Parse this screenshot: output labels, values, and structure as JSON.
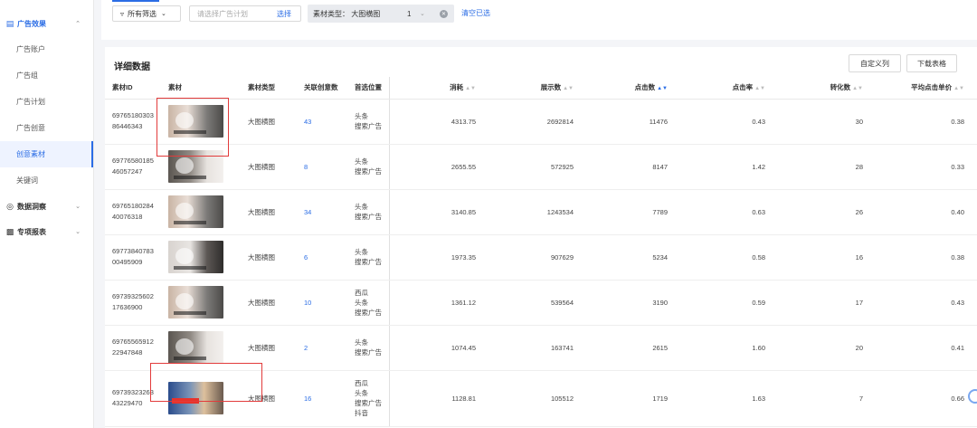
{
  "sidebar": {
    "group_ad": {
      "label": "广告效果",
      "icon": "ad-report-icon"
    },
    "items": [
      {
        "label": "广告账户"
      },
      {
        "label": "广告组"
      },
      {
        "label": "广告计划"
      },
      {
        "label": "广告创意"
      },
      {
        "label": "创意素材",
        "active": true
      },
      {
        "label": "关键词"
      }
    ],
    "group_insight": {
      "label": "数据洞察",
      "icon": "insight-icon"
    },
    "group_special": {
      "label": "专项报表",
      "icon": "bar-chart-icon"
    }
  },
  "filters": {
    "all_filter_label": "所有筛选",
    "plan_placeholder": "请选择广告计划",
    "plan_select_label": "选择",
    "tag_label": "素材类型：  大图横图",
    "tag_count": "1",
    "clear_label": "清空已选"
  },
  "card": {
    "title": "详细数据",
    "custom_columns_label": "自定义列",
    "download_label": "下载表格"
  },
  "table": {
    "columns": [
      "素材ID",
      "素材",
      "素材类型",
      "关联创意数",
      "首选位置",
      "消耗",
      "展示数",
      "点击数",
      "点击率",
      "转化数",
      "平均点击单价"
    ],
    "rows": [
      {
        "id1": "69765180303",
        "id2": "86446343",
        "type": "大图横图",
        "creatives": "43",
        "pos1": "头条",
        "pos2": "搜索广告",
        "pos3": "",
        "pos4": "",
        "cost": "4313.75",
        "impressions": "2692814",
        "clicks": "11476",
        "ctr": "0.43",
        "conversions": "30",
        "cpc": "0.38"
      },
      {
        "id1": "69776580185",
        "id2": "46057247",
        "type": "大图横图",
        "creatives": "8",
        "pos1": "头条",
        "pos2": "搜索广告",
        "pos3": "",
        "pos4": "",
        "cost": "2655.55",
        "impressions": "572925",
        "clicks": "8147",
        "ctr": "1.42",
        "conversions": "28",
        "cpc": "0.33"
      },
      {
        "id1": "69765180284",
        "id2": "40076318",
        "type": "大图横图",
        "creatives": "34",
        "pos1": "头条",
        "pos2": "搜索广告",
        "pos3": "",
        "pos4": "",
        "cost": "3140.85",
        "impressions": "1243534",
        "clicks": "7789",
        "ctr": "0.63",
        "conversions": "26",
        "cpc": "0.40"
      },
      {
        "id1": "69773840783",
        "id2": "00495909",
        "type": "大图横图",
        "creatives": "6",
        "pos1": "头条",
        "pos2": "搜索广告",
        "pos3": "",
        "pos4": "",
        "cost": "1973.35",
        "impressions": "907629",
        "clicks": "5234",
        "ctr": "0.58",
        "conversions": "16",
        "cpc": "0.38"
      },
      {
        "id1": "69739325602",
        "id2": "17636900",
        "type": "大图横图",
        "creatives": "10",
        "pos1": "西瓜",
        "pos2": "头条",
        "pos3": "搜索广告",
        "pos4": "",
        "cost": "1361.12",
        "impressions": "539564",
        "clicks": "3190",
        "ctr": "0.59",
        "conversions": "17",
        "cpc": "0.43"
      },
      {
        "id1": "69765565912",
        "id2": "22947848",
        "type": "大图横图",
        "creatives": "2",
        "pos1": "头条",
        "pos2": "搜索广告",
        "pos3": "",
        "pos4": "",
        "cost": "1074.45",
        "impressions": "163741",
        "clicks": "2615",
        "ctr": "1.60",
        "conversions": "20",
        "cpc": "0.41"
      },
      {
        "id1": "69739323263",
        "id2": "43229470",
        "type": "大图横图",
        "creatives": "16",
        "pos1": "西瓜",
        "pos2": "头条",
        "pos3": "搜索广告",
        "pos4": "抖音",
        "cost": "1128.81",
        "impressions": "105512",
        "clicks": "1719",
        "ctr": "1.63",
        "conversions": "7",
        "cpc": "0.66"
      }
    ]
  },
  "colors": {
    "accent": "#2b6de5",
    "highlight_box": "#e23b3b"
  }
}
